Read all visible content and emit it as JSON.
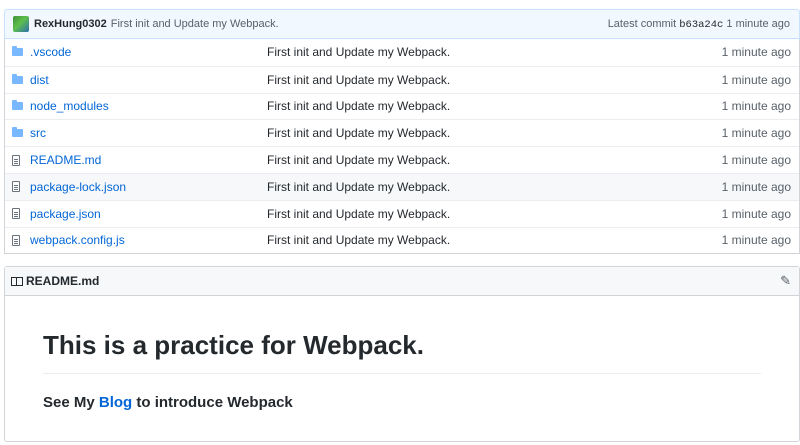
{
  "commit": {
    "author": "RexHung0302",
    "message": "First init and Update my Webpack.",
    "latest_label": "Latest commit",
    "sha": "b63a24c",
    "age": "1 minute ago"
  },
  "files": [
    {
      "name": ".vscode",
      "type": "folder",
      "message": "First init and Update my Webpack.",
      "age": "1 minute ago"
    },
    {
      "name": "dist",
      "type": "folder",
      "message": "First init and Update my Webpack.",
      "age": "1 minute ago"
    },
    {
      "name": "node_modules",
      "type": "folder",
      "message": "First init and Update my Webpack.",
      "age": "1 minute ago"
    },
    {
      "name": "src",
      "type": "folder",
      "message": "First init and Update my Webpack.",
      "age": "1 minute ago"
    },
    {
      "name": "README.md",
      "type": "file",
      "message": "First init and Update my Webpack.",
      "age": "1 minute ago"
    },
    {
      "name": "package-lock.json",
      "type": "file",
      "message": "First init and Update my Webpack.",
      "age": "1 minute ago"
    },
    {
      "name": "package.json",
      "type": "file",
      "message": "First init and Update my Webpack.",
      "age": "1 minute ago"
    },
    {
      "name": "webpack.config.js",
      "type": "file",
      "message": "First init and Update my Webpack.",
      "age": "1 minute ago"
    }
  ],
  "readme": {
    "filename": "README.md",
    "heading": "This is a practice for Webpack.",
    "text_before": "See My ",
    "link_text": "Blog",
    "text_after": " to introduce Webpack"
  }
}
